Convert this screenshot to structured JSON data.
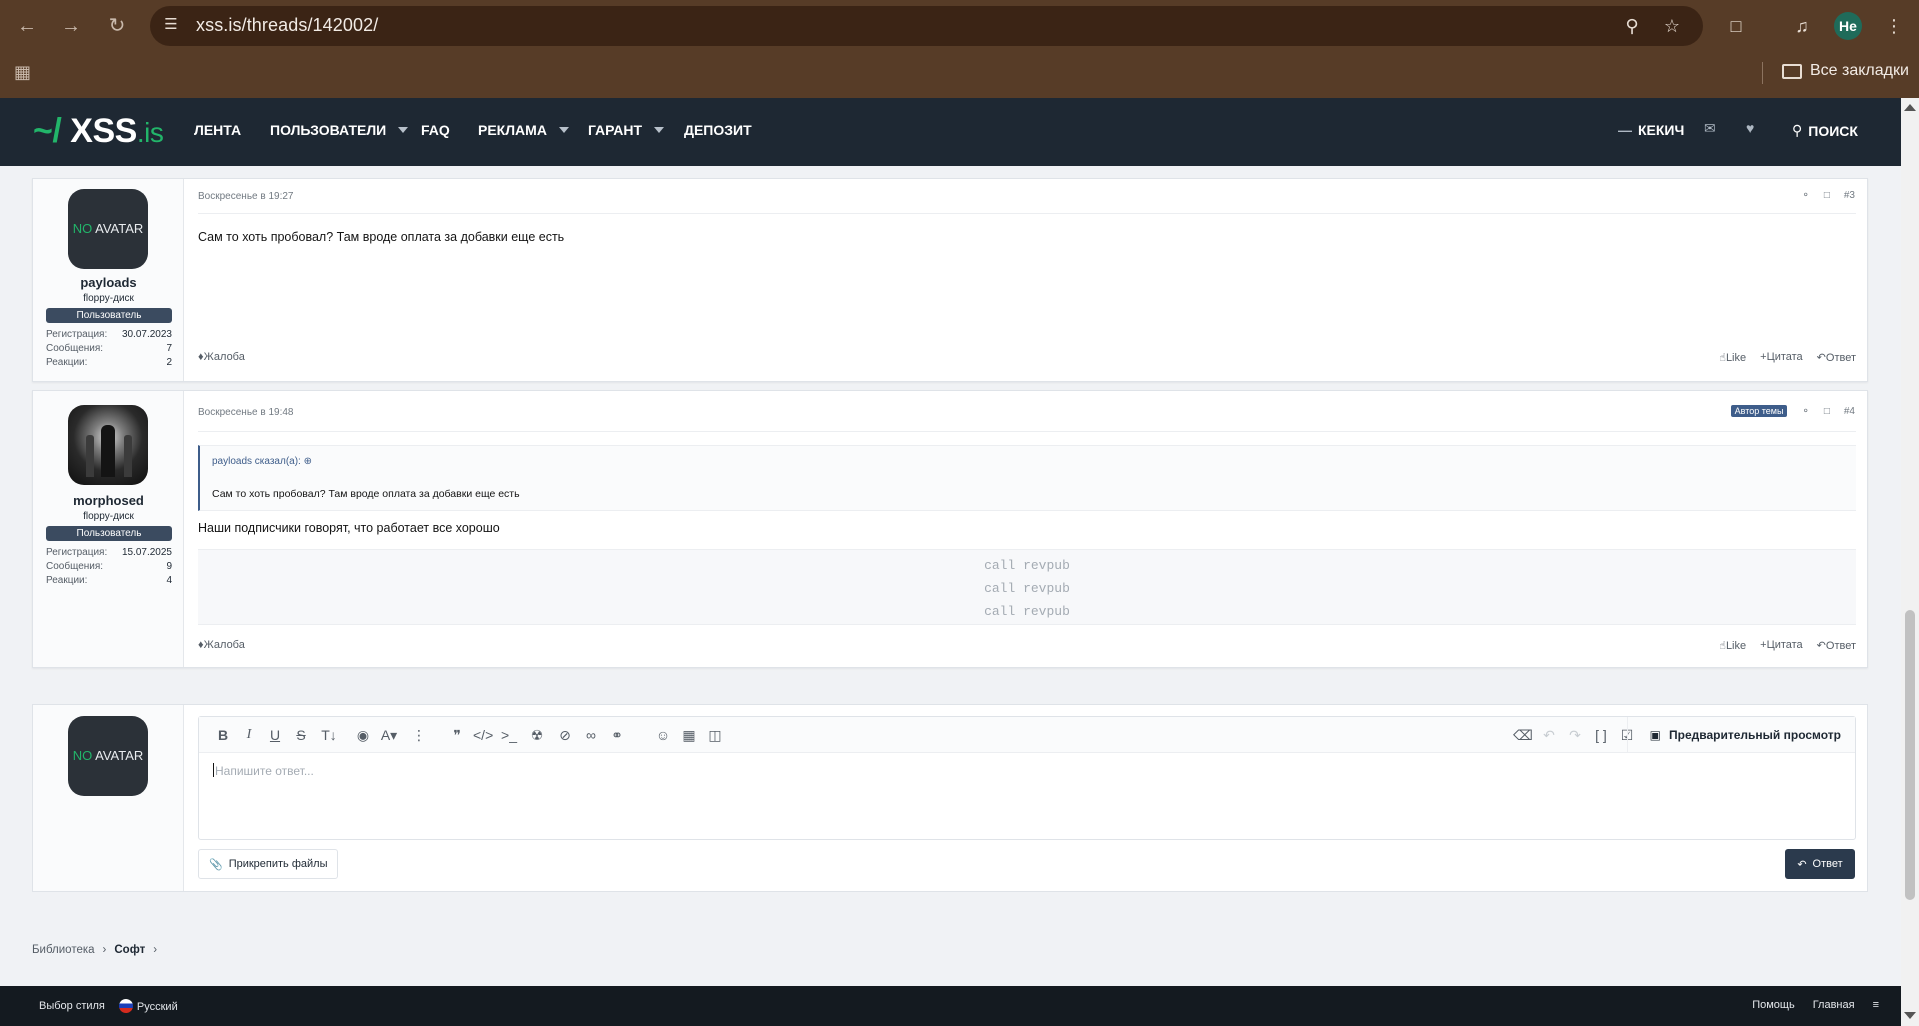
{
  "browser": {
    "url": "xss.is/threads/142002/",
    "profile_initials": "He",
    "all_bookmarks": "Все закладки"
  },
  "header": {
    "logo_tilde": "~/",
    "logo_main": "XSS",
    "logo_suffix": ".is",
    "nav": [
      {
        "label": "ЛЕНТА"
      },
      {
        "label": "ПОЛЬЗОВАТЕЛИ"
      },
      {
        "label": "FAQ"
      },
      {
        "label": "РЕКЛАМА"
      },
      {
        "label": "ГАРАНТ"
      },
      {
        "label": "ДЕПОЗИТ"
      }
    ],
    "user": "КЕКИЧ",
    "search": "ПОИСК"
  },
  "labels": {
    "registration": "Регистрация:",
    "messages": "Сообщения:",
    "reactions": "Реакции:",
    "report": "Жалоба",
    "like": "Like",
    "quote": "Цитата",
    "reply": "Ответ"
  },
  "posts": [
    {
      "avatar_text_no": "NO",
      "avatar_text_rest": " AVATAR",
      "username": "payloads",
      "user_title": "floppy-диск",
      "user_badge": "Пользователь",
      "registration": "30.07.2023",
      "messages": "7",
      "reactions": "2",
      "date": "Воскресенье в 19:27",
      "number": "#3",
      "body": "Сам то хоть пробовал? Там вроде оплата за добавки еще есть"
    },
    {
      "username": "morphosed",
      "user_title": "floppy-диск",
      "user_badge": "Пользователь",
      "registration": "15.07.2025",
      "messages": "9",
      "reactions": "4",
      "date": "Воскресенье в 19:48",
      "author_badge": "Автор темы",
      "number": "#4",
      "quote_author": "payloads сказал(а):",
      "quote_text": "Сам то хоть пробовал? Там вроде оплата за добавки еще есть",
      "body": "Наши подписчики говорят, что работает все хорошо",
      "code_lines": [
        "call revpub",
        "call revpub",
        "call revpub"
      ]
    }
  ],
  "editor": {
    "avatar_text_no": "NO",
    "avatar_text_rest": " AVATAR",
    "placeholder": "Напишите ответ...",
    "preview": "Предварительный просмотр",
    "attach": "Прикрепить файлы",
    "submit": "Ответ"
  },
  "breadcrumb": {
    "items": [
      "Библиотека",
      "Софт"
    ]
  },
  "footer": {
    "style_chooser": "Выбор стиля",
    "language": "Русский",
    "help": "Помощь",
    "home": "Главная"
  },
  "colors": {
    "browser_frame": "#573c27",
    "forum_header": "#1e2833",
    "accent_green": "#22b56a",
    "badge_blue": "#3e5d8a"
  }
}
